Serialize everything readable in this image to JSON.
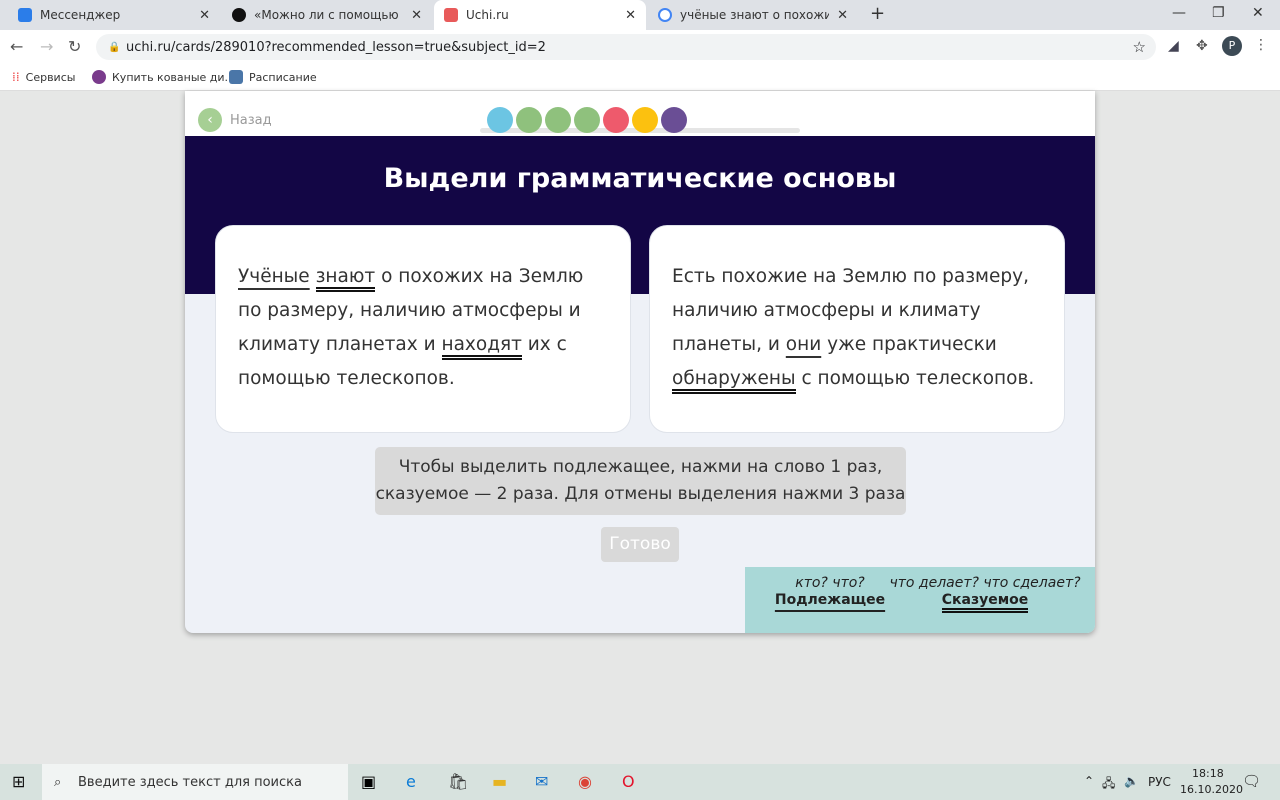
{
  "browser": {
    "tabs": [
      {
        "title": "Мессенджер",
        "color": "#2b7de9"
      },
      {
        "title": "«Можно ли с помощью Яндекс",
        "color": "#111111"
      },
      {
        "title": "Uchi.ru",
        "color": "#e85a5a"
      },
      {
        "title": "учёные знают о похожих на зем",
        "color": "#4285f4"
      }
    ],
    "url": "uchi.ru/cards/289010?recommended_lesson=true&subject_id=2",
    "bookmarks": [
      "Сервисы",
      "Купить кованые ди...",
      "Расписание"
    ],
    "profile_initial": "P"
  },
  "lesson": {
    "back_label": "Назад",
    "progress_colors": [
      "#6cc5e3",
      "#8fc17d",
      "#8fc17d",
      "#8fc17d",
      "#ee5a6c",
      "#fcc10f",
      "#6a4e95"
    ],
    "title": "Выдели грамматические основы",
    "cards": [
      {
        "segments": [
          {
            "text": "Учёные",
            "role": "subject"
          },
          {
            "text": " ",
            "role": ""
          },
          {
            "text": "знают",
            "role": "predicate"
          },
          {
            "text": " о похожих на Землю по размеру, наличию атмосферы и климату планетах и ",
            "role": ""
          },
          {
            "text": "находят",
            "role": "predicate"
          },
          {
            "text": " их с помощью телескопов.",
            "role": ""
          }
        ]
      },
      {
        "segments": [
          {
            "text": "Есть похожие на Землю по размеру, наличию атмосферы и климату планеты, и ",
            "role": ""
          },
          {
            "text": "они",
            "role": "subject"
          },
          {
            "text": " уже практически ",
            "role": ""
          },
          {
            "text": "обнаружены",
            "role": "predicate"
          },
          {
            "text": " с помощью телескопов.",
            "role": ""
          }
        ]
      }
    ],
    "hint_line1": "Чтобы выделить подлежащее, нажми на слово 1 раз,",
    "hint_line2": "сказуемое — 2 раза. Для отмены выделения нажми 3 раза",
    "ready_label": "Готово",
    "legend": {
      "subject_question": "кто? что?",
      "subject_label": "Подлежащее",
      "predicate_question": "что делает? что сделает?",
      "predicate_label": "Сказуемое"
    }
  },
  "taskbar": {
    "search_placeholder": "Введите здесь текст для поиска",
    "lang": "РУС",
    "time": "18:18",
    "date": "16.10.2020"
  }
}
